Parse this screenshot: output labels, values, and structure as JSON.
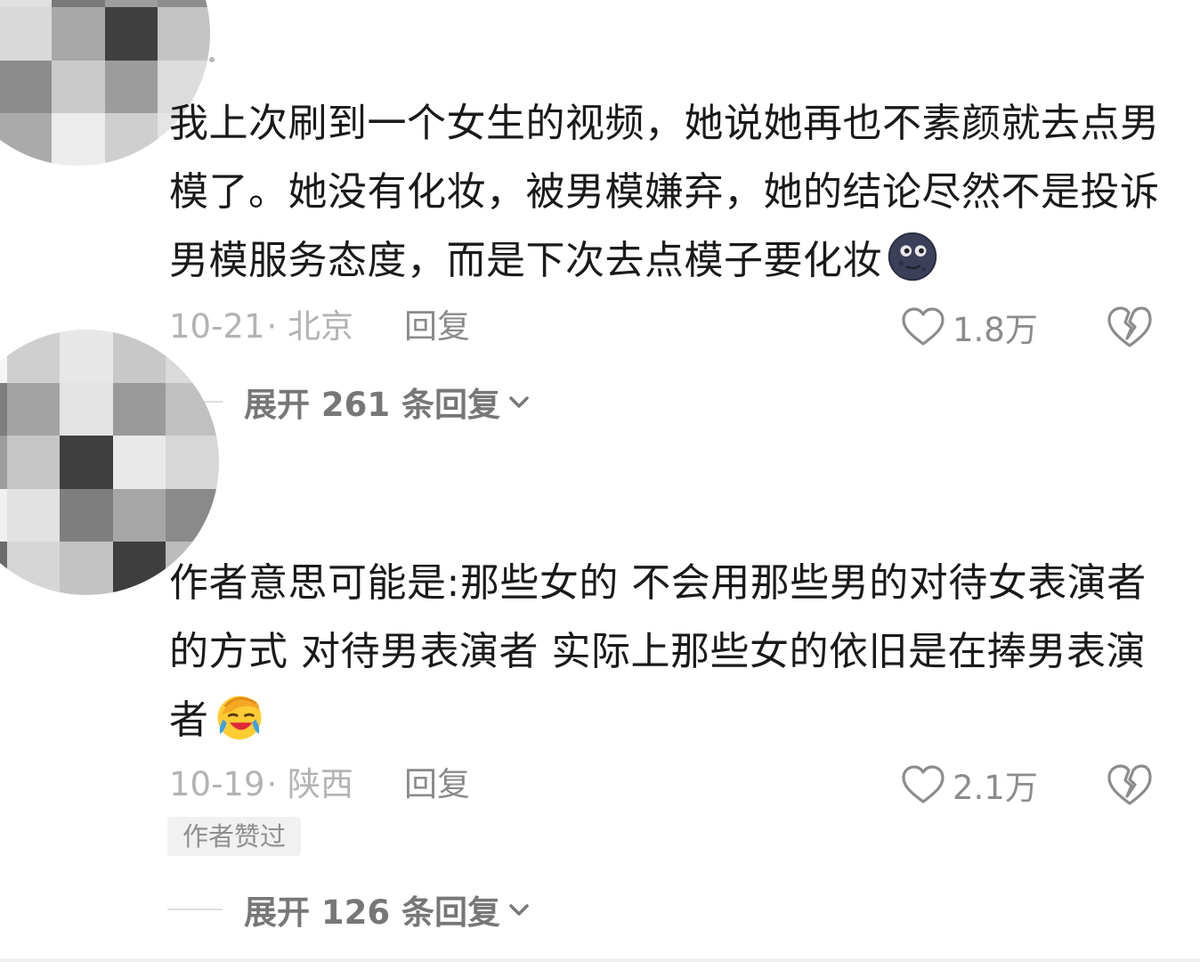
{
  "comments": [
    {
      "avatar_icon": "blurred-avatar-icon",
      "text": "我上次刷到一个女生的视频，她说她再也不素颜就去点男模了。她没有化妆，被男模嫌弃，她的结论尽然不是投诉男模服务态度，而是下次去点模子要化妆",
      "emoji": "new-moon-face-icon",
      "date": "10-21",
      "location": "· 北京",
      "reply_label": "回复",
      "likes": "1.8万",
      "dislike_icon": "broken-heart-icon",
      "expand_label": "展开 261 条回复"
    },
    {
      "avatar_icon": "blurred-avatar-icon",
      "text": "作者意思可能是:那些女的 不会用那些男的对待女表演者的方式 对待男表演者 实际上那些女的依旧是在捧男表演者",
      "emoji": "face-palm-crying-icon",
      "date": "10-19",
      "location": "· 陕西",
      "reply_label": "回复",
      "likes": "2.1万",
      "dislike_icon": "broken-heart-icon",
      "author_badge": "作者赞过",
      "expand_label": "展开 126 条回复"
    }
  ],
  "colors": {
    "text": "#1a1a1a",
    "meta": "#b3b3b3",
    "reply": "#8a8a8a",
    "expand": "#777777"
  }
}
